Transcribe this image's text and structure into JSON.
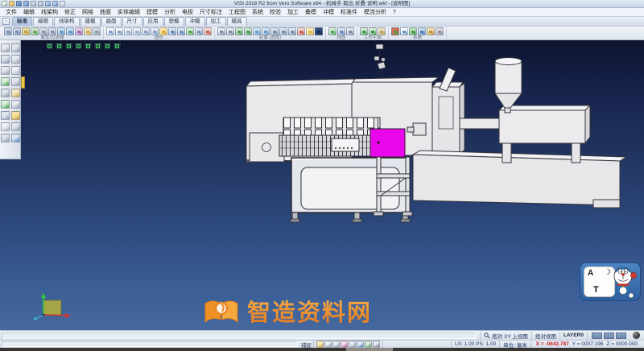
{
  "window": {
    "title": "VISI 2018 R2 from Vero Software x64 - 机械手 取出 折叠 说明.wkf - [说明图]"
  },
  "titlebar": {
    "icons": [
      {
        "name": "new-file-icon",
        "c1": "#ffffff",
        "c2": "#7fb069"
      },
      {
        "name": "open-folder-icon",
        "c1": "#f5d67b",
        "c2": "#d9a13b"
      },
      {
        "name": "save-icon",
        "c1": "#7b9fd4",
        "c2": "#3c66a8"
      },
      {
        "name": "save-all-icon",
        "c1": "#9db8e0",
        "c2": "#5578b5"
      },
      {
        "name": "print-icon",
        "c1": "#d8dde5",
        "c2": "#9aa3b0"
      },
      {
        "name": "print-preview-icon",
        "c1": "#cfd8e6",
        "c2": "#8fa0bb"
      },
      {
        "name": "undo-icon",
        "c1": "#bcd0ee",
        "c2": "#4a76c0"
      },
      {
        "name": "redo-icon",
        "c1": "#bcd0ee",
        "c2": "#4a76c0"
      },
      {
        "name": "customize-arrow-icon",
        "c1": "#e8edf5",
        "c2": "#b9c4d6"
      }
    ]
  },
  "menu": {
    "items": [
      "文件",
      "编辑",
      "线架构",
      "修正",
      "网格",
      "曲面",
      "实体编辑",
      "建模",
      "分析",
      "电极",
      "尺寸标注",
      "工程图",
      "系统",
      "校验",
      "加工",
      "叠模",
      "冲模",
      "标准件",
      "模流分析",
      "?"
    ]
  },
  "tabs": {
    "collapse_label": "-",
    "items": [
      {
        "label": "标准",
        "active": true
      },
      {
        "label": "编辑"
      },
      {
        "label": "线架构"
      },
      {
        "label": "建模"
      },
      {
        "label": "曲面"
      },
      {
        "label": "尺寸"
      },
      {
        "label": "应用"
      },
      {
        "label": "塑模"
      },
      {
        "label": "冲模"
      },
      {
        "label": "加工"
      },
      {
        "label": "模具"
      }
    ]
  },
  "toolbar": {
    "groups": [
      {
        "label": "属性/过滤器",
        "icons": [
          {
            "name": "attribute-paint-icon",
            "c1": "#cdd6e4",
            "c2": "#6f8ab0"
          },
          {
            "name": "attribute-match-icon",
            "c1": "#cdd6e4",
            "c2": "#6f8ab0"
          },
          {
            "name": "layer-manager-icon",
            "c1": "#e8d9a0",
            "c2": "#b99b3e"
          },
          {
            "name": "filter-all-icon",
            "c1": "#cfe3cf",
            "c2": "#5c9e5c"
          },
          {
            "name": "filter-points-icon",
            "c1": "#d8dee8",
            "c2": "#7d8da6"
          },
          {
            "name": "filter-curves-icon",
            "c1": "#d8dee8",
            "c2": "#7d8da6"
          },
          {
            "name": "filter-surfaces-icon",
            "c1": "#cfe0ef",
            "c2": "#5b8cc0"
          },
          {
            "name": "filter-solids-icon",
            "c1": "#cfe0ef",
            "c2": "#5b8cc0"
          },
          {
            "name": "filter-mesh-icon",
            "c1": "#e3d2e8",
            "c2": "#9a5fb0"
          },
          {
            "name": "quick-filter-icon",
            "c1": "#f0e3c2",
            "c2": "#caa94e"
          },
          {
            "name": "selection-mode-icon",
            "c1": "#d5dde9",
            "c2": "#8496ad"
          }
        ]
      },
      {
        "label": "图形",
        "icons": [
          {
            "name": "redraw-icon",
            "c1": "#ffffff",
            "c2": "#6f95c8"
          },
          {
            "name": "regen-all-icon",
            "c1": "#ffffff",
            "c2": "#6f95c8"
          },
          {
            "name": "hide-entity-icon",
            "c1": "#f2f4f8",
            "c2": "#8aa6cc"
          },
          {
            "name": "show-all-icon",
            "c1": "#f2f4f8",
            "c2": "#8aa6cc"
          },
          {
            "name": "blank-icon",
            "c1": "#e9edf4",
            "c2": "#7a99c4"
          },
          {
            "name": "unblank-icon",
            "c1": "#e9edf4",
            "c2": "#7a99c4"
          },
          {
            "name": "highlight-icon",
            "c1": "#ffe9a8",
            "c2": "#d9a32e"
          },
          {
            "name": "group-icon",
            "c1": "#dfe7f2",
            "c2": "#5b82b8"
          },
          {
            "name": "ungroup-icon",
            "c1": "#dfe7f2",
            "c2": "#5b82b8"
          },
          {
            "name": "entity-info-icon",
            "c1": "#d8f0d8",
            "c2": "#4d9e4d"
          },
          {
            "name": "copy-entity-icon",
            "c1": "#e4e9f1",
            "c2": "#7188a8"
          },
          {
            "name": "delete-entity-icon",
            "c1": "#f2dcd8",
            "c2": "#c05a48"
          }
        ]
      },
      {
        "label": "影像 (透视)",
        "icons": [
          {
            "name": "wireframe-view-icon",
            "c1": "#e8ecf2",
            "c2": "#70829e"
          },
          {
            "name": "hidden-line-view-icon",
            "c1": "#e8ecf2",
            "c2": "#70829e"
          },
          {
            "name": "shaded-view-icon",
            "c1": "#cfe6cf",
            "c2": "#3f8f4f"
          },
          {
            "name": "shaded-edges-view-icon",
            "c1": "#cfe6cf",
            "c2": "#3f8f4f"
          },
          {
            "name": "transparency-view-icon",
            "c1": "#d6e6f2",
            "c2": "#5d92c0"
          },
          {
            "name": "perspective-view-icon",
            "c1": "#d6e6f2",
            "c2": "#5d92c0"
          },
          {
            "name": "dynamic-rotate-icon",
            "c1": "#dce4ee",
            "c2": "#6a84a8"
          },
          {
            "name": "dynamic-pan-icon",
            "c1": "#dce4ee",
            "c2": "#6a84a8"
          },
          {
            "name": "dynamic-zoom-icon",
            "c1": "#dce4ee",
            "c2": "#6a84a8"
          },
          {
            "name": "render-settings-icon",
            "c1": "#f0d8d4",
            "c2": "#c4503c"
          },
          {
            "name": "lighting-icon",
            "c1": "#fdeeba",
            "c2": "#dcb23a"
          },
          {
            "name": "background-color-icon",
            "c1": "#2e4e80",
            "c2": "#152a4e"
          }
        ]
      },
      {
        "label": "视图",
        "icons": [
          {
            "name": "zoom-fit-icon",
            "c1": "#d9e8d9",
            "c2": "#3f9e4f"
          },
          {
            "name": "zoom-window-icon",
            "c1": "#dae4f0",
            "c2": "#5b82b8"
          },
          {
            "name": "previous-view-icon",
            "c1": "#e4e8ee",
            "c2": "#70829e"
          }
        ]
      },
      {
        "label": "工作平面",
        "icons": [
          {
            "name": "workplane-icon",
            "c1": "#d9e8d9",
            "c2": "#2f8f3f"
          },
          {
            "name": "workplane-align-icon",
            "c1": "#d9e8d9",
            "c2": "#2f8f3f"
          },
          {
            "name": "workplane-origin-icon",
            "c1": "#e8e4d0",
            "c2": "#b09a4a"
          }
        ]
      },
      {
        "label": "系统",
        "icons": [
          {
            "name": "system-colors-icon",
            "c1": "#e06a5a",
            "c2": "#4a9e4a"
          },
          {
            "name": "system-window-icon",
            "c1": "#ffffff",
            "c2": "#5b8cc0"
          },
          {
            "name": "system-refresh-icon",
            "c1": "#bfe3bf",
            "c2": "#3f8f3f"
          },
          {
            "name": "system-calendar-icon",
            "c1": "#cfe0f2",
            "c2": "#3f6fae"
          },
          {
            "name": "system-snap-icon",
            "c1": "#f2e3b8",
            "c2": "#c08a2e"
          },
          {
            "name": "system-tools-icon",
            "c1": "#d9d9de",
            "c2": "#8a8a94"
          }
        ]
      }
    ]
  },
  "sidebar": {
    "icons": [
      {
        "name": "sb-open-icon",
        "c1": "#e6e9ee",
        "c2": "#98a2b2"
      },
      {
        "name": "sb-mask-icon",
        "c1": "#dfe3ea",
        "c2": "#8b96a8"
      },
      {
        "name": "sb-wire-icon",
        "c1": "#e6e9ee",
        "c2": "#98a2b2"
      },
      {
        "name": "sb-check-icon",
        "c1": "#d8eed8",
        "c2": "#3f9e3f"
      },
      {
        "name": "sb-solid-icon",
        "c1": "#dfe3ea",
        "c2": "#8b96a8"
      },
      {
        "name": "sb-verify-icon",
        "c1": "#d8eed8",
        "c2": "#3f9e3f"
      },
      {
        "name": "sb-surface-icon",
        "c1": "#e2e6ec",
        "c2": "#93a0b4"
      },
      {
        "name": "sb-doc-icon",
        "c1": "#eef0f4",
        "c2": "#a8b2c2"
      },
      {
        "name": "sb-gear-icon",
        "c1": "#dfe3ea",
        "c2": "#8b96a8"
      },
      {
        "name": "sb-clamp-icon",
        "c1": "#e2e6ec",
        "c2": "#93a0b4"
      },
      {
        "name": "sb-spring-icon",
        "c1": "#e6e9ee",
        "c2": "#98a2b2"
      },
      {
        "name": "sb-corner-icon",
        "c1": "#eef0f4",
        "c2": "#a8b2c2"
      },
      {
        "name": "sb-drill-icon",
        "c1": "#e2e6ec",
        "c2": "#93a0b4"
      },
      {
        "name": "sb-round-icon",
        "c1": "#f4e6c6",
        "c2": "#c8a23e"
      },
      {
        "name": "sb-tool-icon",
        "c1": "#e6e9ee",
        "c2": "#98a2b2"
      },
      {
        "name": "sb-macro-icon",
        "c1": "#f6e2a2",
        "c2": "#cf9e2e"
      },
      {
        "name": "sb-box-icon",
        "c1": "#e2e6ec",
        "c2": "#93a0b4"
      },
      {
        "name": "sb-globe-icon",
        "c1": "#d8e6f2",
        "c2": "#4f82b8"
      }
    ]
  },
  "viewbar": {
    "icons": [
      {
        "name": "view-top-icon",
        "c1": "#2a3b58",
        "c2": "#39d24e"
      },
      {
        "name": "view-bottom-icon",
        "c1": "#2a3b58",
        "c2": "#39d24e"
      },
      {
        "name": "view-front-icon",
        "c1": "#2a3b58",
        "c2": "#39d24e"
      },
      {
        "name": "view-back-icon",
        "c1": "#2a3b58",
        "c2": "#39d24e"
      },
      {
        "name": "view-left-icon",
        "c1": "#2a3b58",
        "c2": "#39d24e"
      },
      {
        "name": "view-right-icon",
        "c1": "#2a3b58",
        "c2": "#39d24e"
      },
      {
        "name": "view-iso-icon",
        "c1": "#2a3b58",
        "c2": "#39d24e"
      },
      {
        "name": "view-trimetric-icon",
        "c1": "#2a3b58",
        "c2": "#39d24e"
      }
    ]
  },
  "watermark": {
    "text": "智造资料网"
  },
  "sticker": {
    "char_a": "A",
    "char_moon": "☽",
    "char_t": "T"
  },
  "statusbar": {
    "abs_view": "绝对 XY 上视图",
    "view_name": "绝对视图",
    "layer": "LAYER0",
    "swatches": [
      {
        "name": "line-color-swatch",
        "c1": "#8aa2c2",
        "c2": "#6e88ac"
      },
      {
        "name": "fill-color-swatch",
        "c1": "#8aa2c2",
        "c2": "#6e88ac"
      },
      {
        "name": "layer-color-swatch",
        "c1": "#8aa2c2",
        "c2": "#6e88ac"
      }
    ],
    "snap_label": "捕捉",
    "snap_icons": [
      {
        "name": "snap-toggle-icon",
        "c1": "#f4e6c0",
        "c2": "#c89c32"
      },
      {
        "name": "snap-endpoint-icon",
        "c1": "#e8ebf0",
        "c2": "#8e99ab"
      },
      {
        "name": "snap-midpoint-icon",
        "c1": "#e8ebf0",
        "c2": "#8e99ab"
      },
      {
        "name": "snap-center-icon",
        "c1": "#f2dcea",
        "c2": "#bc5694"
      },
      {
        "name": "snap-quadrant-icon",
        "c1": "#e8ebf0",
        "c2": "#8e99ab"
      },
      {
        "name": "snap-intersect-icon",
        "c1": "#dde8f4",
        "c2": "#4f7fb8"
      },
      {
        "name": "snap-rotate-icon",
        "c1": "#dceadc",
        "c2": "#4f9e5f"
      },
      {
        "name": "snap-grid-icon",
        "c1": "#e8e9ee",
        "c2": "#6e7890"
      }
    ],
    "ls_ps": "LS: 1.00 PS: 1.00",
    "units": "单位: 毫米",
    "coord_x": "X = -0642.787",
    "coord_y": "Y = 0007.196",
    "coord_z": "Z = 0000.000"
  },
  "colors": {
    "selection_highlight": "#ea06ea",
    "viewport_top": "#0d142e",
    "viewport_bottom": "#45689f",
    "watermark_orange": "#ef9a2e"
  }
}
